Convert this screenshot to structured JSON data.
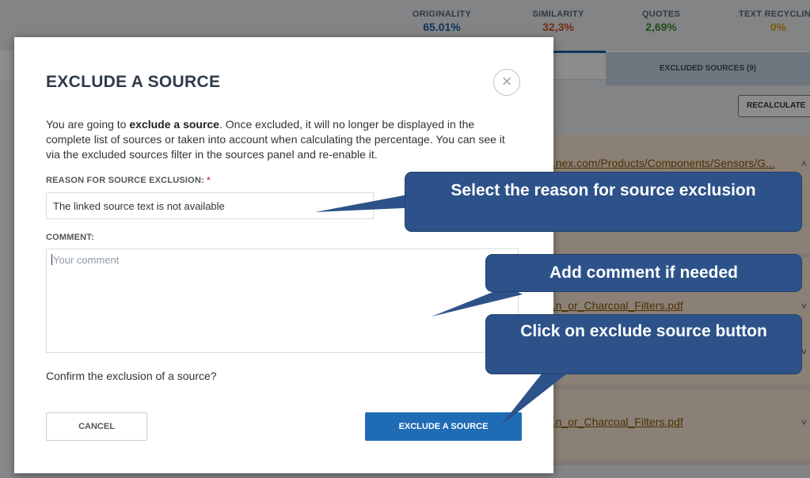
{
  "background": {
    "stats": [
      {
        "label": "ORIGINALITY",
        "value": "65.01%",
        "color": "#1b5fa8"
      },
      {
        "label": "SIMILARITY",
        "value": "32,3%",
        "color": "#d2511e"
      },
      {
        "label": "QUOTES",
        "value": "2,69%",
        "color": "#3d8a2e"
      },
      {
        "label": "TEXT RECYCLING",
        "value": "0%",
        "color": "#e3a20b"
      }
    ],
    "excluded_tab": "EXCLUDED SOURCES (9)",
    "recalculate_button": "RECALCULATE",
    "source_links": [
      "...nex.com/Products/Components/Sensors/G...",
      "...n_or_Charcoal_Filters.pdf",
      "...n_or_Charcoal_Filters.pdf"
    ]
  },
  "modal": {
    "title": "EXCLUDE A SOURCE",
    "intro_pre": "You are going to ",
    "intro_bold": "exclude a source",
    "intro_post": ". Once excluded, it will no longer be displayed in the complete list of sources or taken into account when calculating the percentage. You can see it via the excluded sources filter in the sources panel and re-enable it.",
    "reason_label": "REASON FOR SOURCE EXCLUSION:",
    "required_mark": "*",
    "reason_value": "The linked source text is not available",
    "comment_label": "COMMENT:",
    "comment_placeholder": "Your comment",
    "confirm_text": "Confirm the exclusion of a source?",
    "cancel_label": "CANCEL",
    "exclude_label": "EXCLUDE A SOURCE"
  },
  "callouts": {
    "reason": "Select the reason for source exclusion",
    "comment": "Add comment if needed",
    "exclude": "Click on exclude source button"
  },
  "colors": {
    "callout_bg": "#2c5289",
    "primary_button": "#1f6cb5",
    "title_text": "#2d3b4c"
  }
}
